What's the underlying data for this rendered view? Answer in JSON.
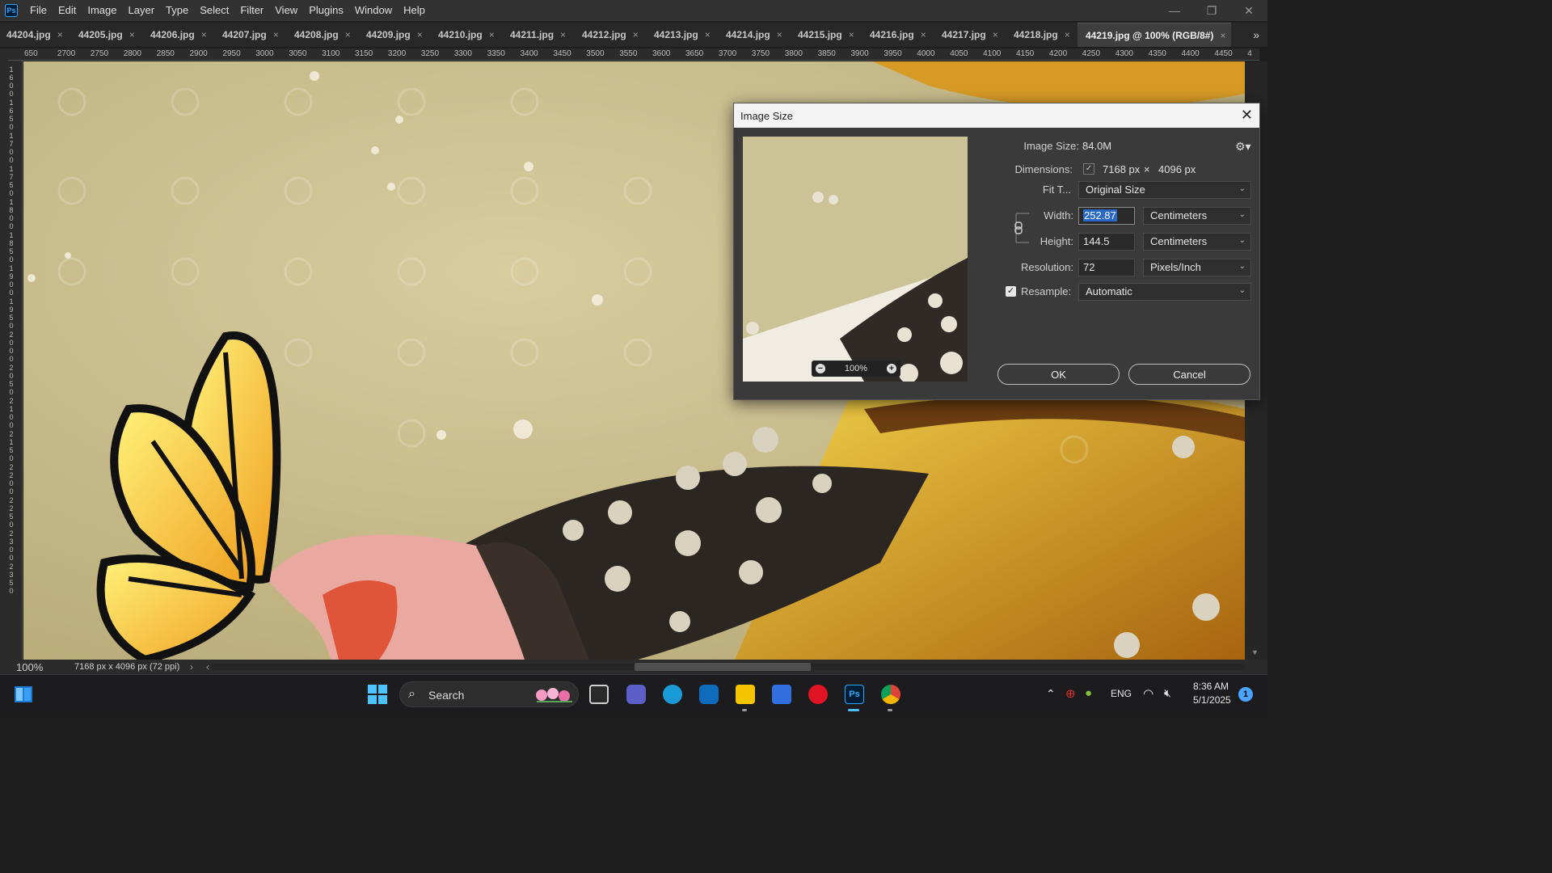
{
  "app": {
    "logo": "Ps",
    "menu": [
      "File",
      "Edit",
      "Image",
      "Layer",
      "Type",
      "Select",
      "Filter",
      "View",
      "Plugins",
      "Window",
      "Help"
    ]
  },
  "tabs": {
    "items": [
      "44204.jpg",
      "44205.jpg",
      "44206.jpg",
      "44207.jpg",
      "44208.jpg",
      "44209.jpg",
      "44210.jpg",
      "44211.jpg",
      "44212.jpg",
      "44213.jpg",
      "44214.jpg",
      "44215.jpg",
      "44216.jpg",
      "44217.jpg",
      "44218.jpg"
    ],
    "active": "44219.jpg @ 100% (RGB/8#)",
    "close_glyph": "×",
    "overflow": "»"
  },
  "ruler": {
    "h_labels": [
      "650",
      "2700",
      "2750",
      "2800",
      "2850",
      "2900",
      "2950",
      "3000",
      "3050",
      "3100",
      "3150",
      "3200",
      "3250",
      "3300",
      "3350",
      "3400",
      "3450",
      "3500",
      "3550",
      "3600",
      "3650",
      "3700",
      "3750",
      "3800",
      "3850",
      "3900",
      "3950",
      "4000",
      "4050",
      "4100",
      "4150",
      "4200",
      "4250",
      "4300",
      "4350",
      "4400",
      "4450",
      "4"
    ],
    "v_labels": [
      "1600",
      "1650",
      "1700",
      "1750",
      "1800",
      "1850",
      "1900",
      "1950",
      "2000",
      "2050",
      "2100",
      "2150",
      "2200",
      "2250",
      "2300",
      "2350"
    ]
  },
  "status": {
    "zoom": "100%",
    "doc_info": "7168 px x 4096 px (72 ppi)",
    "arrow": "›",
    "left_arrow": "‹"
  },
  "dialog": {
    "title": "Image Size",
    "close": "✕",
    "image_size_label": "Image Size:",
    "image_size_value": "84.0M",
    "dimensions_label": "Dimensions:",
    "dim_width": "7168 px",
    "dim_x": "×",
    "dim_height": "4096 px",
    "fit_label": "Fit T...",
    "fit_value": "Original Size",
    "width_label": "Width:",
    "width_value": "252.87",
    "width_unit": "Centimeters",
    "height_label": "Height:",
    "height_value": "144.5",
    "height_unit": "Centimeters",
    "resolution_label": "Resolution:",
    "resolution_value": "72",
    "resolution_unit": "Pixels/Inch",
    "resample_label": "Resample:",
    "resample_checked": true,
    "resample_value": "Automatic",
    "preview_zoom": "100%",
    "ok": "OK",
    "cancel": "Cancel"
  },
  "taskbar": {
    "search_placeholder": "Search",
    "lang": "ENG",
    "time": "8:36 AM",
    "date": "5/1/2025",
    "notifications": "1"
  },
  "colors": {
    "accent_blue": "#2a68c8",
    "ps_blue": "#31a8ff"
  }
}
